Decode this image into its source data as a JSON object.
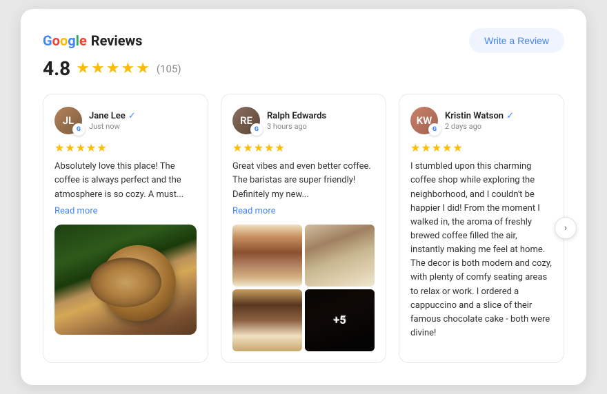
{
  "header": {
    "brand_g": "G",
    "brand_o1": "o",
    "brand_o2": "o",
    "brand_g2": "g",
    "brand_l": "l",
    "brand_e": "e",
    "title": "Reviews",
    "rating": "4.8",
    "review_count": "(105)",
    "write_review_label": "Write a Review"
  },
  "reviews": [
    {
      "id": "jane-lee",
      "name": "Jane Lee",
      "time": "Just now",
      "avatar_initials": "JL",
      "stars": 5,
      "text": "Absolutely love this place! The coffee is always perfect and the atmosphere is so cozy. A must...",
      "read_more": "Read more",
      "has_single_image": true
    },
    {
      "id": "ralph-edwards",
      "name": "Ralph Edwards",
      "time": "3 hours ago",
      "avatar_initials": "RE",
      "stars": 5,
      "text": "Great vibes and even better coffee. The baristas are super friendly! Definitely my new...",
      "read_more": "Read more",
      "has_grid_images": true
    },
    {
      "id": "kristin-watson",
      "name": "Kristin Watson",
      "time": "2 days ago",
      "avatar_initials": "KW",
      "stars": 5,
      "text": "I stumbled upon this charming coffee shop while exploring the neighborhood, and I couldn't be happier I did! From the moment I walked in, the aroma of freshly brewed coffee filled the air, instantly making me feel at home. The decor is both modern and cozy, with plenty of comfy seating areas to relax or work. I ordered a cappuccino and a slice of their famous chocolate cake - both were divine!",
      "has_long_text": true
    }
  ],
  "nav": {
    "next_arrow": "›"
  }
}
